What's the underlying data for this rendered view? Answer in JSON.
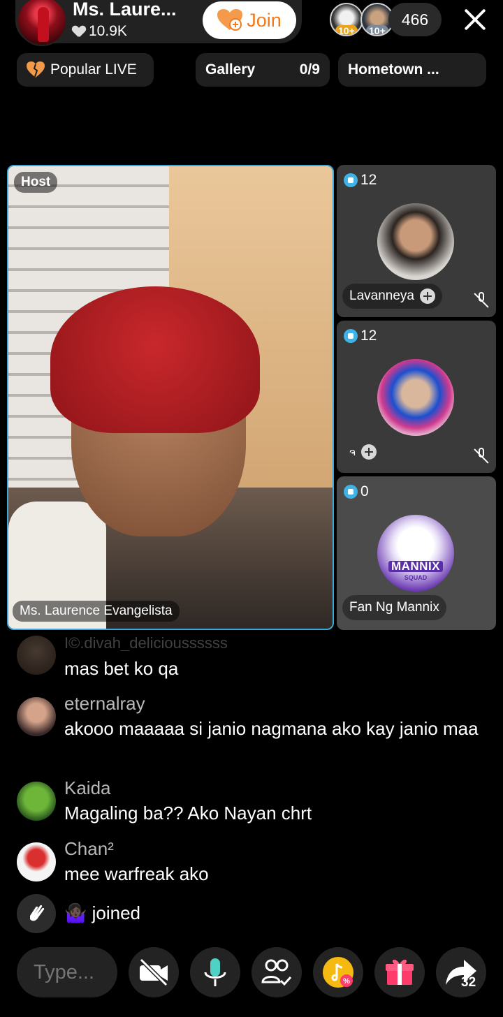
{
  "header": {
    "host_name": "Ms. Laure...",
    "host_likes": "10.9K",
    "join_label": "Join",
    "viewer_badges": [
      "10+",
      "10+"
    ],
    "viewer_count": "466"
  },
  "chips": {
    "popular_label": "Popular LIVE",
    "gallery_label": "Gallery",
    "gallery_count": "0/9",
    "hometown_label": "Hometown ..."
  },
  "host_tile": {
    "tag": "Host",
    "name": "Ms. Laurence Evangelista"
  },
  "guests": [
    {
      "score": "12",
      "name": "Lavanneya",
      "muted": true
    },
    {
      "score": "12",
      "name": "ຈ",
      "muted": true
    },
    {
      "score": "0",
      "name": "Fan Ng Mannix",
      "logo_top": "MANNIX",
      "logo_bottom": "SQUAD"
    }
  ],
  "chat": {
    "messages": [
      {
        "user": "I©.divah_delicioussssss",
        "text": "mas bet ko qa"
      },
      {
        "user": "eternalray",
        "text": "akooo maaaaa si janio nagmana ako kay janio maa"
      },
      {
        "user": "Kaida",
        "text": "Magaling ba?? Ako Nayan chrt"
      },
      {
        "user": "Chan²",
        "text": "mee warfreak ako"
      }
    ],
    "join_event": "🤷🏿‍♀️ joined"
  },
  "bottom_bar": {
    "input_placeholder": "Type...",
    "share_count": "32"
  },
  "colors": {
    "accent_join": "#f07a1c",
    "host_border": "#3fa6d8",
    "gift": "#ff3b6b",
    "mic": "#4fd1c5"
  }
}
